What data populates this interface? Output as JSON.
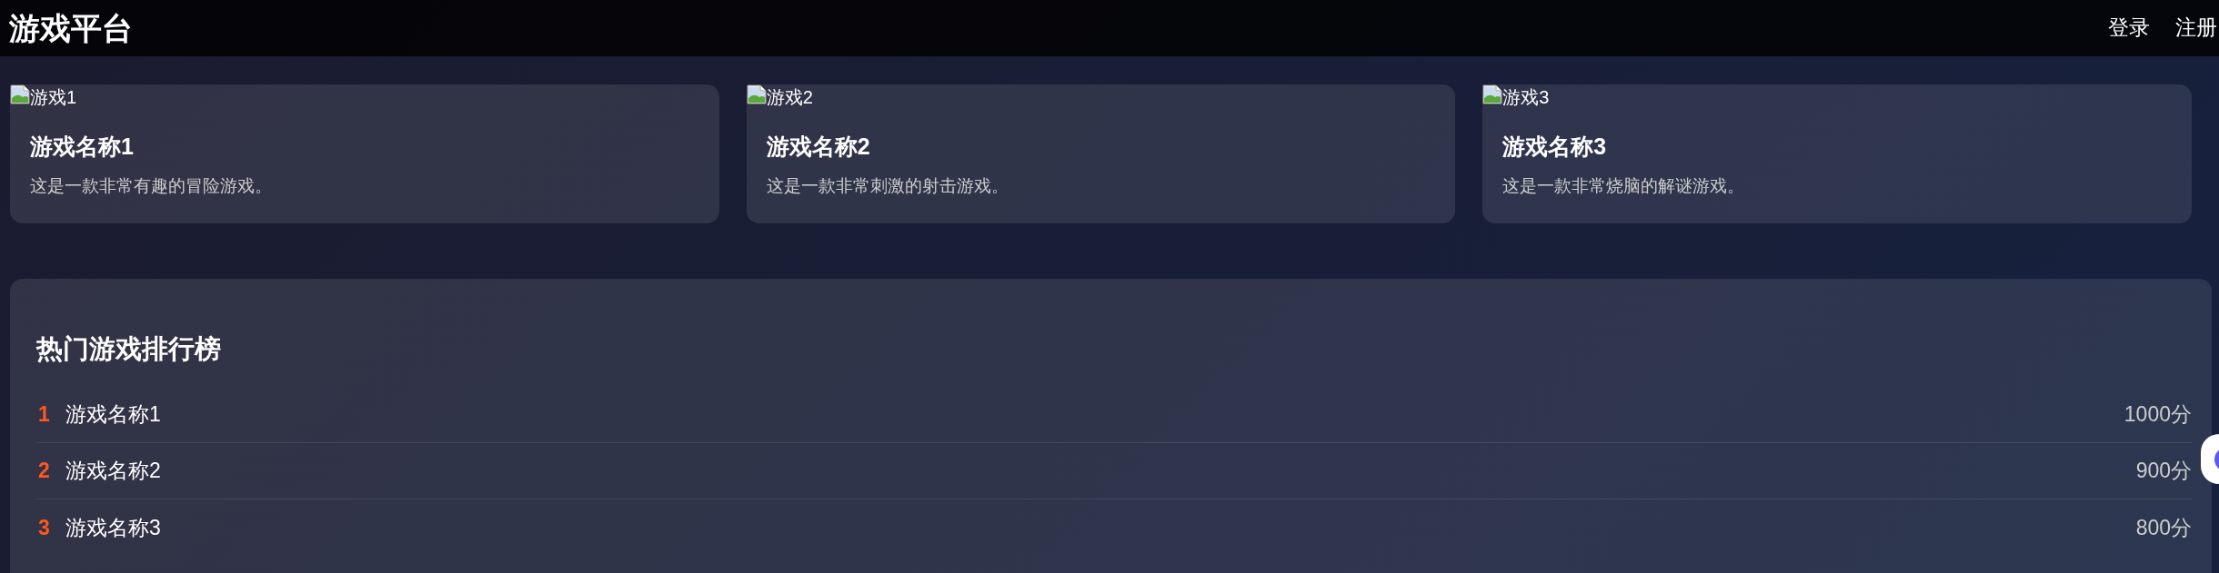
{
  "header": {
    "logo": "游戏平台",
    "nav": [
      {
        "label": "登录"
      },
      {
        "label": "注册"
      }
    ]
  },
  "games": [
    {
      "image_alt": "游戏1",
      "title": "游戏名称1",
      "description": "这是一款非常有趣的冒险游戏。"
    },
    {
      "image_alt": "游戏2",
      "title": "游戏名称2",
      "description": "这是一款非常刺激的射击游戏。"
    },
    {
      "image_alt": "游戏3",
      "title": "游戏名称3",
      "description": "这是一款非常烧脑的解谜游戏。"
    }
  ],
  "ranking": {
    "title": "热门游戏排行榜",
    "rows": [
      {
        "rank": "1",
        "name": "游戏名称1",
        "score": "1000分"
      },
      {
        "rank": "2",
        "name": "游戏名称2",
        "score": "900分"
      },
      {
        "rank": "3",
        "name": "游戏名称3",
        "score": "800分"
      }
    ]
  }
}
